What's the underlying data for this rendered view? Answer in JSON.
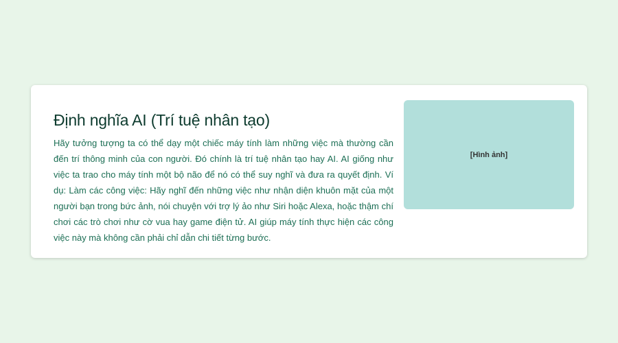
{
  "card": {
    "title": "Định nghĩa AI (Trí tuệ nhân tạo)",
    "body": "Hãy tưởng tượng ta có thể dạy một chiếc máy tính làm những việc mà thường cần đến trí thông minh của con người. Đó chính là trí tuệ nhân tạo hay AI. AI giống như việc ta trao cho máy tính một bộ não để nó có thể suy nghĩ và đưa ra quyết định. Ví dụ: Làm các công việc: Hãy nghĩ đến những việc như nhận diện khuôn mặt của một người bạn trong bức ảnh, nói chuyện với trợ lý ảo như Siri hoặc Alexa, hoặc thậm chí chơi các trò chơi như cờ vua hay game điện tử. AI giúp máy tính thực hiện các công việc này mà không cần phải chỉ dẫn chi tiết từng bước.",
    "image_label": "[Hình ảnh]"
  },
  "colors": {
    "page_background": "#e8f5e9",
    "card_background": "#ffffff",
    "title_color": "#0d3b2e",
    "body_color": "#1b6e54",
    "image_background": "#b2dfdb"
  }
}
